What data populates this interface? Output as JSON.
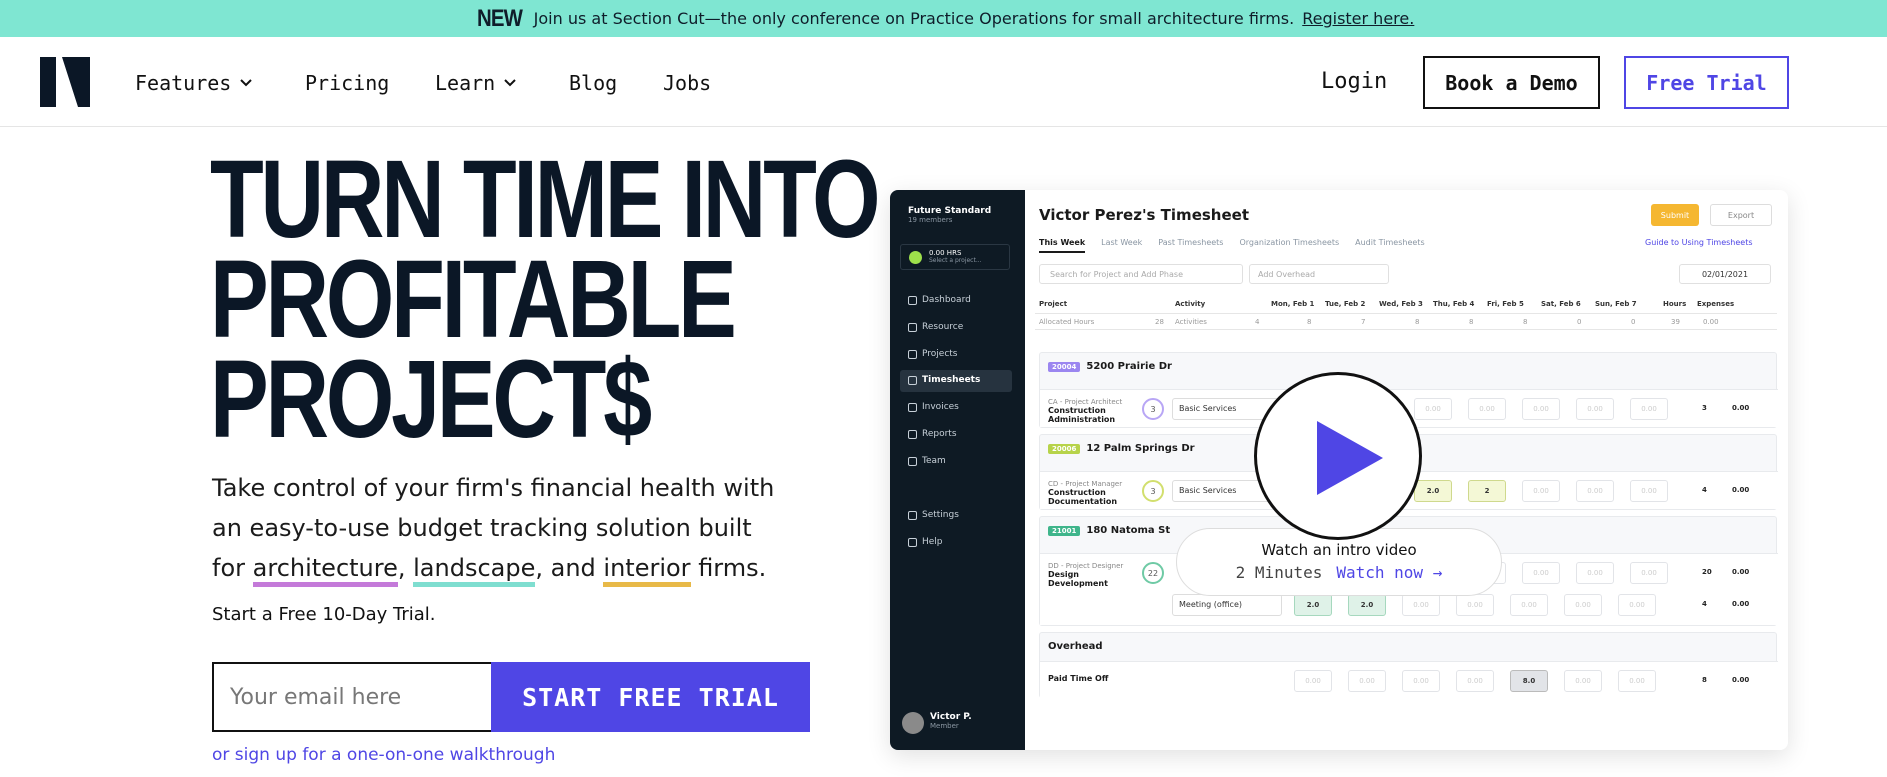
{
  "banner": {
    "new_label": "NEW",
    "message": "Join us at Section Cut—the only conference on Practice Operations for small architecture firms.",
    "link_label": "Register here."
  },
  "nav": {
    "features": "Features",
    "pricing": "Pricing",
    "learn": "Learn",
    "blog": "Blog",
    "jobs": "Jobs",
    "login": "Login",
    "book_demo": "Book a Demo",
    "free_trial": "Free Trial"
  },
  "hero": {
    "title_lines": [
      "TURN TIME INTO",
      "PROFITABLE",
      "PROJECT$"
    ],
    "desc_start": "Take control of your firm's financial health with an easy-to-use budget tracking solution built for",
    "w1": "architecture",
    "w2": "landscape",
    "w3": "interior",
    "desc_end": "firms.",
    "trial_note": "Start a Free 10-Day Trial.",
    "email_placeholder": "Your email here",
    "start_button": "START FREE TRIAL",
    "walkthrough_link": "or sign up for a one-on-one walkthrough"
  },
  "app": {
    "org_name": "Future Standard",
    "org_members": "19 members",
    "timer_hrs": "0.00 HRS",
    "timer_sub": "Select a project...",
    "sidebar": [
      "Dashboard",
      "Resource",
      "Projects",
      "Timesheets",
      "Invoices",
      "Reports",
      "Team"
    ],
    "sidebar_active": "Timesheets",
    "settings": "Settings",
    "help": "Help",
    "user_name": "Victor P.",
    "user_role": "Member",
    "title": "Victor Perez's Timesheet",
    "submit": "Submit",
    "export": "Export",
    "tabs": [
      "This Week",
      "Last Week",
      "Past Timesheets",
      "Organization Timesheets",
      "Audit Timesheets"
    ],
    "guide": "Guide to Using Timesheets",
    "search_placeholder": "Search for Project and Add Phase",
    "overhead_placeholder": "Add Overhead",
    "date": "02/01/2021",
    "headers": [
      "Project",
      "Activity",
      "Mon, Feb 1",
      "Tue, Feb 2",
      "Wed, Feb 3",
      "Thu, Feb 4",
      "Fri, Feb 5",
      "Sat, Feb 6",
      "Sun, Feb 7",
      "Hours",
      "Expenses"
    ],
    "alloc_label": "Allocated Hours",
    "alloc_hours": "28",
    "alloc_activities": "Activities",
    "alloc_values": [
      "4",
      "8",
      "7",
      "8",
      "8",
      "8",
      "0",
      "0",
      "39",
      "0.00"
    ],
    "groups": [
      {
        "code": "20004",
        "name": "5200 Prairie Dr",
        "color": "#9b86f0",
        "role": "CA - Project Architect",
        "phase": "Construction Administration",
        "num": "3",
        "activity": "Basic Services",
        "hours": "3",
        "exp": "0.00"
      },
      {
        "code": "20006",
        "name": "12 Palm Springs Dr",
        "color": "#b7d34a",
        "role": "CD - Project Manager",
        "phase": "Construction Documentation",
        "num": "3",
        "activity": "Basic Services",
        "hours": "4",
        "exp": "0.00"
      },
      {
        "code": "21001",
        "name": "180 Natoma St",
        "color": "#3fb58b",
        "role": "DD - Project Designer",
        "phase": "Design Development",
        "num": "22",
        "activity": "Meeting (office)",
        "hours": "20",
        "exp": "0.00",
        "hours2": "4"
      }
    ],
    "cell_values": {
      "g2_thu": "2.0",
      "g2_fri": "2",
      "g3_mon": "2.0",
      "g3_tue": "2.0",
      "oh_fri": "8.0"
    },
    "empty_cell": "0.00",
    "overhead_title": "Overhead",
    "overhead_row": "Paid Time Off",
    "overhead_hours": "8",
    "currency": "$"
  },
  "video": {
    "caption": "Watch an intro video",
    "duration": "2 Minutes",
    "watch_now": "Watch now →"
  }
}
